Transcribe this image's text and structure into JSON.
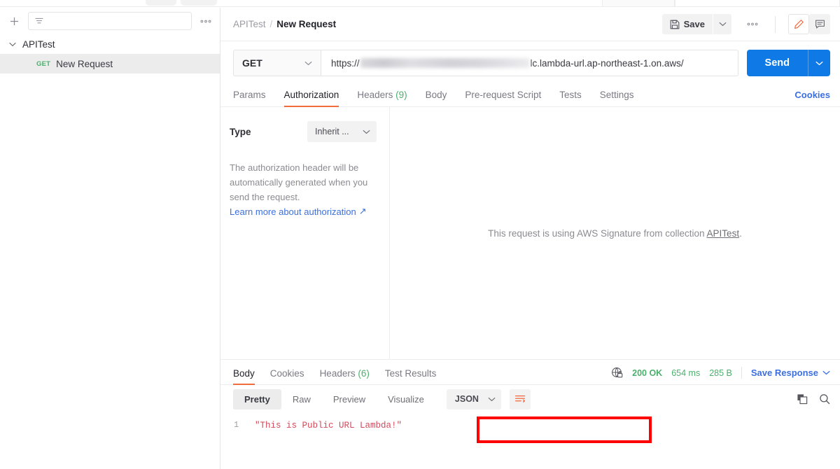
{
  "sidebar": {
    "add_label": "+",
    "filter_placeholder": "",
    "more_label": "…",
    "collection": {
      "name": "APITest",
      "expanded": true
    },
    "request": {
      "method": "GET",
      "name": "New Request"
    }
  },
  "header": {
    "breadcrumb": {
      "collection": "APITest",
      "separator": "/",
      "current": "New Request"
    },
    "save_label": "Save",
    "save_caret": "⌄",
    "more_label": "…"
  },
  "url_bar": {
    "method": "GET",
    "method_caret": "⌄",
    "url_prefix": "https://",
    "url_suffix": "lc.lambda-url.ap-northeast-1.on.aws/",
    "send_label": "Send",
    "send_caret": "⌄"
  },
  "request_tabs": {
    "items": [
      {
        "label": "Params",
        "count": "",
        "active": false
      },
      {
        "label": "Authorization",
        "count": "",
        "active": true
      },
      {
        "label": "Headers",
        "count": "(9)",
        "active": false
      },
      {
        "label": "Body",
        "count": "",
        "active": false
      },
      {
        "label": "Pre-request Script",
        "count": "",
        "active": false
      },
      {
        "label": "Tests",
        "count": "",
        "active": false
      },
      {
        "label": "Settings",
        "count": "",
        "active": false
      }
    ],
    "cookies_label": "Cookies"
  },
  "authorization": {
    "type_label": "Type",
    "type_value": "Inherit ...",
    "type_caret": "⌄",
    "description": "The authorization header will be automatically generated when you send the request.",
    "learn_more": "Learn more about authorization",
    "learn_more_icon": "↗",
    "message_prefix": "This request is using AWS Signature from collection ",
    "message_collection": "APITest",
    "message_suffix": "."
  },
  "response": {
    "tabs": [
      {
        "label": "Body",
        "count": "",
        "active": true
      },
      {
        "label": "Cookies",
        "count": "",
        "active": false
      },
      {
        "label": "Headers",
        "count": "(6)",
        "active": false
      },
      {
        "label": "Test Results",
        "count": "",
        "active": false
      }
    ],
    "status": "200 OK",
    "time": "654 ms",
    "size": "285 B",
    "save_response_label": "Save Response",
    "save_response_caret": "⌄",
    "formats": [
      {
        "label": "Pretty",
        "active": true
      },
      {
        "label": "Raw",
        "active": false
      },
      {
        "label": "Preview",
        "active": false
      },
      {
        "label": "Visualize",
        "active": false
      }
    ],
    "language": "JSON",
    "language_caret": "⌄",
    "body_lines": [
      {
        "number": "1",
        "text": "\"This is Public URL Lambda!\""
      }
    ]
  },
  "colors": {
    "accent_orange": "#f26b3a",
    "send_blue": "#0f7ae5",
    "link_blue": "#3b6fe0",
    "status_green": "#4caf6d",
    "body_red": "#d5485a",
    "highlight_red": "#ff0000"
  }
}
